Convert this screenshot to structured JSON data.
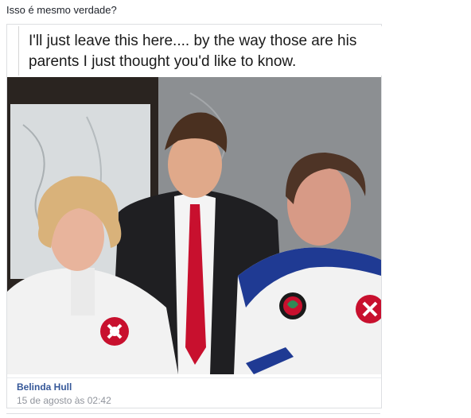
{
  "post": {
    "text": "Isso é mesmo verdade?"
  },
  "shared_card": {
    "caption_line1": "I'll just leave this here.... by the way those are his",
    "caption_line2": "parents I just thought you'd like to know.",
    "author": "Belinda Hull",
    "date": "15 de agosto às 02:42"
  },
  "colors": {
    "author_link": "#365899",
    "meta_text": "#90949c",
    "tie": "#c8102e",
    "robe": "#f2f2f2",
    "robe_trim": "#1f3a93"
  }
}
